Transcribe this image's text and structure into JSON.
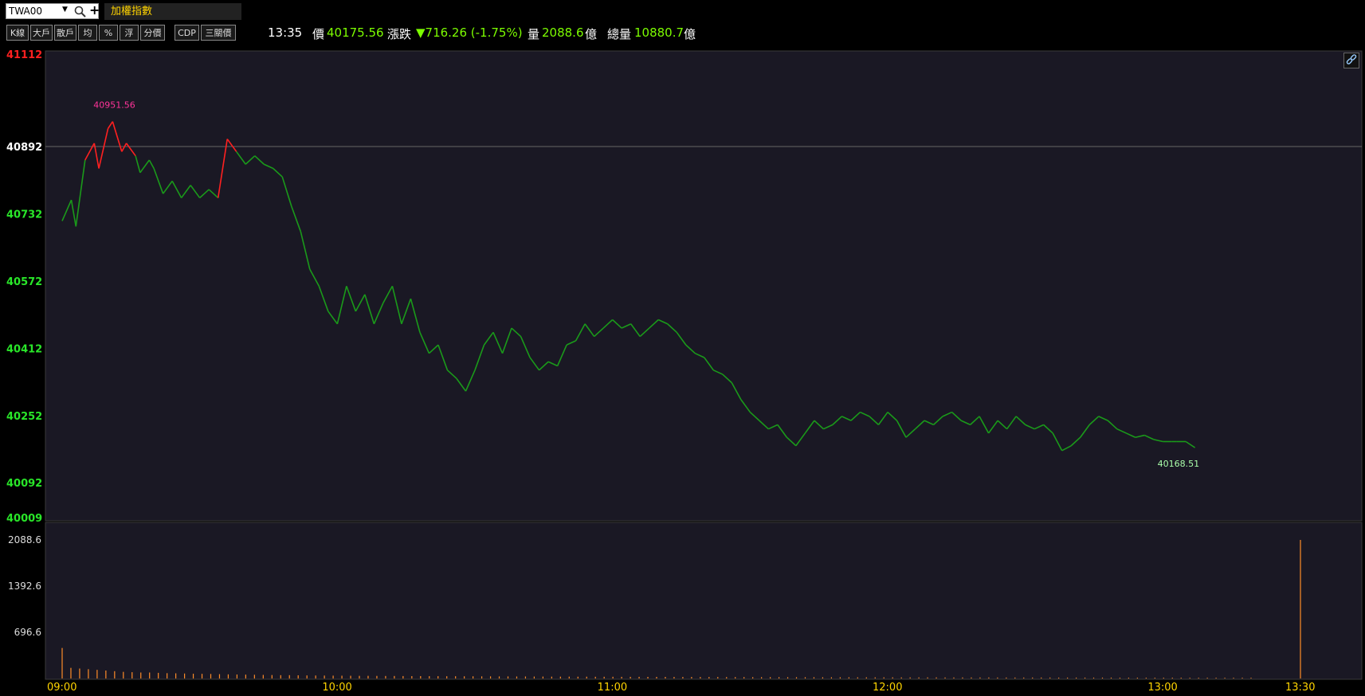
{
  "header": {
    "symbol": "TWA00",
    "index_name": "加權指數"
  },
  "toolbar": {
    "buttons": [
      "K線",
      "大戶",
      "散戶",
      "均",
      "%",
      "浮",
      "分價",
      "CDP",
      "三關價"
    ]
  },
  "quote": {
    "time": "13:35",
    "price_label": "價",
    "price": "40175.56",
    "change_label": "漲跌",
    "change": "▼716.26 (-1.75%)",
    "volume_label": "量",
    "volume": "2088.6",
    "volume_unit": "億",
    "total_volume_label": "總量",
    "total_volume": "10880.7",
    "total_volume_unit": "億"
  },
  "colors": {
    "up": "#ff2020",
    "down": "#1a9a1a",
    "volume": "#ff8c28",
    "background": "#1a1824",
    "axis_time": "#ffd400"
  },
  "chart_data": [
    {
      "type": "line",
      "title": "",
      "reference_price": 40892,
      "ylim": [
        40009,
        41112
      ],
      "y_tick_labels": [
        "41112",
        "40892",
        "40732",
        "40572",
        "40412",
        "40252",
        "40092",
        "40009"
      ],
      "x_tick_labels": [
        "09:00",
        "10:00",
        "11:00",
        "12:00",
        "13:00",
        "13:30"
      ],
      "annotations": [
        {
          "text": "40951.56",
          "x": "09:11",
          "y": 40951.56
        },
        {
          "text": "40168.51",
          "x": "13:03",
          "y": 40168.51
        }
      ],
      "x": [
        "09:00",
        "09:02",
        "09:03",
        "09:05",
        "09:07",
        "09:08",
        "09:10",
        "09:11",
        "09:13",
        "09:14",
        "09:16",
        "09:17",
        "09:19",
        "09:20",
        "09:22",
        "09:24",
        "09:26",
        "09:28",
        "09:30",
        "09:32",
        "09:34",
        "09:36",
        "09:38",
        "09:40",
        "09:42",
        "09:44",
        "09:46",
        "09:48",
        "09:50",
        "09:52",
        "09:54",
        "09:56",
        "09:58",
        "10:00",
        "10:02",
        "10:04",
        "10:06",
        "10:08",
        "10:10",
        "10:12",
        "10:14",
        "10:16",
        "10:18",
        "10:20",
        "10:22",
        "10:24",
        "10:26",
        "10:28",
        "10:30",
        "10:32",
        "10:34",
        "10:36",
        "10:38",
        "10:40",
        "10:42",
        "10:44",
        "10:46",
        "10:48",
        "10:50",
        "10:52",
        "10:54",
        "10:56",
        "10:58",
        "11:00",
        "11:02",
        "11:04",
        "11:06",
        "11:08",
        "11:10",
        "11:12",
        "11:14",
        "11:16",
        "11:18",
        "11:20",
        "11:22",
        "11:24",
        "11:26",
        "11:28",
        "11:30",
        "11:32",
        "11:34",
        "11:36",
        "11:38",
        "11:40",
        "11:42",
        "11:44",
        "11:46",
        "11:48",
        "11:50",
        "11:52",
        "11:54",
        "11:56",
        "11:58",
        "12:00",
        "12:02",
        "12:04",
        "12:06",
        "12:08",
        "12:10",
        "12:12",
        "12:14",
        "12:16",
        "12:18",
        "12:20",
        "12:22",
        "12:24",
        "12:26",
        "12:28",
        "12:30",
        "12:32",
        "12:34",
        "12:36",
        "12:38",
        "12:40",
        "12:42",
        "12:44",
        "12:46",
        "12:48",
        "12:50",
        "12:52",
        "12:54",
        "12:56",
        "12:58",
        "13:00",
        "13:02",
        "13:03",
        "13:05",
        "13:07",
        "13:09",
        "13:11",
        "13:13",
        "13:15",
        "13:17",
        "13:19",
        "13:21",
        "13:23",
        "13:25",
        "13:30"
      ],
      "series": [
        {
          "values": [
            40715,
            40765,
            40702,
            40860,
            40900,
            40840,
            40935,
            40951.56,
            40880,
            40900,
            40870,
            40830,
            40860,
            40840,
            40780,
            40810,
            40770,
            40800,
            40770,
            40790,
            40770,
            40910,
            40880,
            40850,
            40870,
            40850,
            40840,
            40820,
            40750,
            40690,
            40600,
            40560,
            40500,
            40470,
            40560,
            40500,
            40540,
            40470,
            40520,
            40560,
            40470,
            40530,
            40450,
            40400,
            40420,
            40360,
            40340,
            40310,
            40360,
            40420,
            40450,
            40400,
            40460,
            40440,
            40390,
            40360,
            40380,
            40370,
            40420,
            40430,
            40470,
            40440,
            40460,
            40480,
            40460,
            40470,
            40440,
            40460,
            40480,
            40470,
            40450,
            40420,
            40400,
            40390,
            40360,
            40350,
            40330,
            40290,
            40260,
            40240,
            40220,
            40230,
            40200,
            40180,
            40210,
            40240,
            40220,
            40230,
            40250,
            40240,
            40260,
            40250,
            40230,
            40260,
            40240,
            40200,
            40220,
            40240,
            40230,
            40250,
            40260,
            40240,
            40230,
            40250,
            40210,
            40240,
            40220,
            40250,
            40230,
            40220,
            40230,
            40210,
            40168.51,
            40180,
            40200,
            40230,
            40250,
            40240,
            40220,
            40210,
            40200,
            40205,
            40195,
            40190,
            40190,
            40190,
            40190,
            40175.56
          ]
        }
      ]
    },
    {
      "type": "bar",
      "title": "",
      "ylim": [
        0,
        2088.6
      ],
      "y_tick_labels": [
        "2088.6",
        "1392.6",
        "696.6"
      ],
      "series": [
        {
          "values": [
            460,
            160,
            150,
            140,
            130,
            120,
            110,
            100,
            95,
            90,
            90,
            85,
            80,
            78,
            75,
            72,
            70,
            68,
            65,
            62,
            60,
            58,
            56,
            54,
            52,
            50,
            50,
            48,
            46,
            45,
            44,
            43,
            42,
            41,
            40,
            40,
            39,
            38,
            38,
            37,
            36,
            36,
            35,
            35,
            34,
            34,
            33,
            33,
            32,
            32,
            31,
            31,
            30,
            30,
            29,
            29,
            28,
            28,
            28,
            27,
            27,
            26,
            26,
            26,
            25,
            25,
            25,
            24,
            24,
            24,
            23,
            23,
            23,
            22,
            22,
            22,
            21,
            21,
            21,
            20,
            20,
            20,
            20,
            19,
            19,
            19,
            19,
            18,
            18,
            18,
            18,
            17,
            17,
            17,
            17,
            17,
            16,
            16,
            16,
            16,
            16,
            15,
            15,
            15,
            15,
            15,
            15,
            14,
            14,
            14,
            14,
            14,
            14,
            14,
            13,
            13,
            13,
            13,
            13,
            13,
            13,
            12,
            12,
            12,
            12,
            12,
            12,
            12,
            12,
            11,
            11,
            11,
            11,
            11,
            11,
            11,
            11,
            2088.6
          ]
        }
      ]
    }
  ]
}
